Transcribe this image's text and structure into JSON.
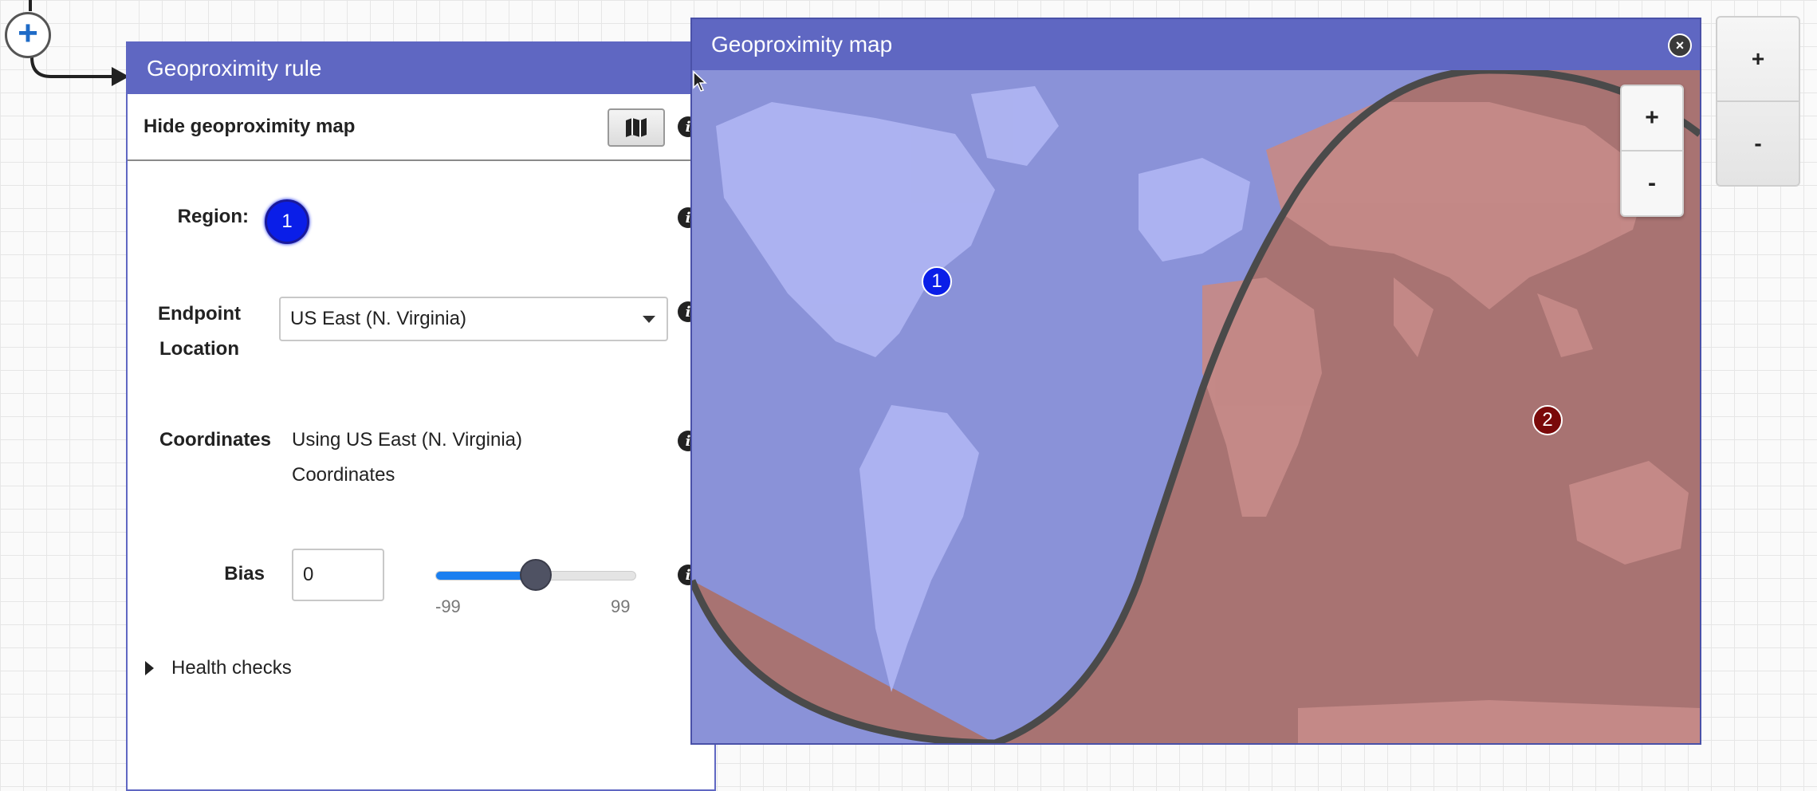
{
  "canvas": {
    "add_button_glyph": "+"
  },
  "rule_panel": {
    "title": "Geoproximity rule",
    "hide_map_label": "Hide geoproximity map",
    "region_label": "Region:",
    "region_value": "1",
    "endpoint_label_line1": "Endpoint",
    "endpoint_label_line2": "Location",
    "endpoint_value": "US East (N. Virginia)",
    "coordinates_label": "Coordinates",
    "coordinates_line1": "Using US East (N. Virginia)",
    "coordinates_line2": "Coordinates",
    "bias_label": "Bias",
    "bias_value": "0",
    "bias_slider": {
      "min": -99,
      "max": 99,
      "value": 0,
      "min_label": "-99",
      "max_label": "99"
    },
    "health_checks_label": "Health checks",
    "info_glyph": "i"
  },
  "map_window": {
    "title": "Geoproximity map",
    "close_glyph": "×",
    "zoom_in": "+",
    "zoom_out": "-",
    "regions": [
      {
        "label": "1",
        "color": "#0a1ee8",
        "fill": "#8a92d8"
      },
      {
        "label": "2",
        "color": "#7a0a0a",
        "fill": "#a87372"
      }
    ]
  },
  "outer_zoom": {
    "zoom_in": "+",
    "zoom_out": "-"
  },
  "colors": {
    "header": "#5f67c2",
    "region1": "#0a1ee8",
    "region2": "#7a0a0a",
    "slider_fill": "#1a7ff0"
  }
}
